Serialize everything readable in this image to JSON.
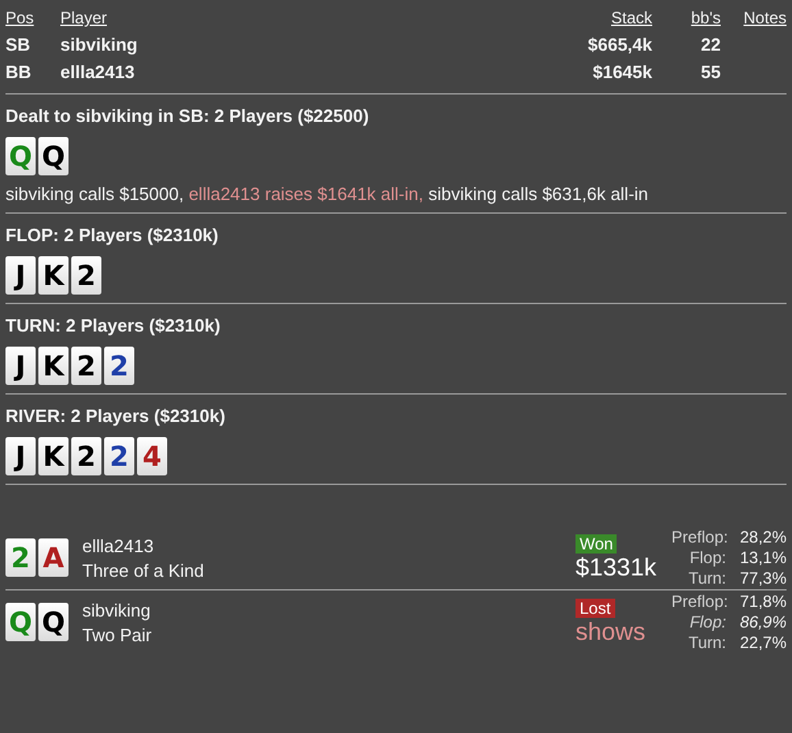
{
  "header": {
    "columns": [
      "Pos",
      "Player",
      "Stack",
      "bb's",
      "Notes"
    ]
  },
  "players": [
    {
      "pos": "SB",
      "name": "sibviking",
      "stack": "$665,4k",
      "bbs": "22"
    },
    {
      "pos": "BB",
      "name": "ellla2413",
      "stack": "$1645k",
      "bbs": "55"
    }
  ],
  "streets": [
    {
      "title": "Dealt to sibviking in SB: 2 Players ($22500)",
      "cards": [
        {
          "rank": "Q",
          "color": "#1a8a1a"
        },
        {
          "rank": "Q",
          "color": "#000000"
        }
      ],
      "actions": [
        {
          "text": "sibviking calls $15000,",
          "highlight": false
        },
        {
          "text": "ellla2413 raises $1641k all-in,",
          "highlight": true
        },
        {
          "text": "sibviking calls $631,6k all-in",
          "highlight": false
        }
      ]
    },
    {
      "title": "FLOP: 2 Players ($2310k)",
      "cards": [
        {
          "rank": "J",
          "color": "#000000"
        },
        {
          "rank": "K",
          "color": "#000000"
        },
        {
          "rank": "2",
          "color": "#000000"
        }
      ]
    },
    {
      "title": "TURN: 2 Players ($2310k)",
      "cards": [
        {
          "rank": "J",
          "color": "#000000"
        },
        {
          "rank": "K",
          "color": "#000000"
        },
        {
          "rank": "2",
          "color": "#000000"
        },
        {
          "rank": "2",
          "color": "#1f3fa8"
        }
      ]
    },
    {
      "title": "RIVER: 2 Players ($2310k)",
      "cards": [
        {
          "rank": "J",
          "color": "#000000"
        },
        {
          "rank": "K",
          "color": "#000000"
        },
        {
          "rank": "2",
          "color": "#000000"
        },
        {
          "rank": "2",
          "color": "#1f3fa8"
        },
        {
          "rank": "4",
          "color": "#b02020"
        }
      ]
    }
  ],
  "results": [
    {
      "name": "ellla2413",
      "hand": "Three of a Kind",
      "cards": [
        {
          "rank": "2",
          "color": "#1a8a1a"
        },
        {
          "rank": "A",
          "color": "#b02020"
        }
      ],
      "outcome": {
        "kind": "won",
        "label": "Won"
      },
      "amount": {
        "kind": "money",
        "text": "$1331k"
      },
      "equity": [
        {
          "label": "Preflop:",
          "value": "28,2%",
          "italic": false
        },
        {
          "label": "Flop:",
          "value": "13,1%",
          "italic": false
        },
        {
          "label": "Turn:",
          "value": "77,3%",
          "italic": false
        }
      ]
    },
    {
      "name": "sibviking",
      "hand": "Two Pair",
      "cards": [
        {
          "rank": "Q",
          "color": "#1a8a1a"
        },
        {
          "rank": "Q",
          "color": "#000000"
        }
      ],
      "outcome": {
        "kind": "lost",
        "label": "Lost"
      },
      "amount": {
        "kind": "shows",
        "text": "shows"
      },
      "equity": [
        {
          "label": "Preflop:",
          "value": "71,8%",
          "italic": false
        },
        {
          "label": "Flop:",
          "value": "86,9%",
          "italic": true
        },
        {
          "label": "Turn:",
          "value": "22,7%",
          "italic": false
        }
      ]
    }
  ]
}
